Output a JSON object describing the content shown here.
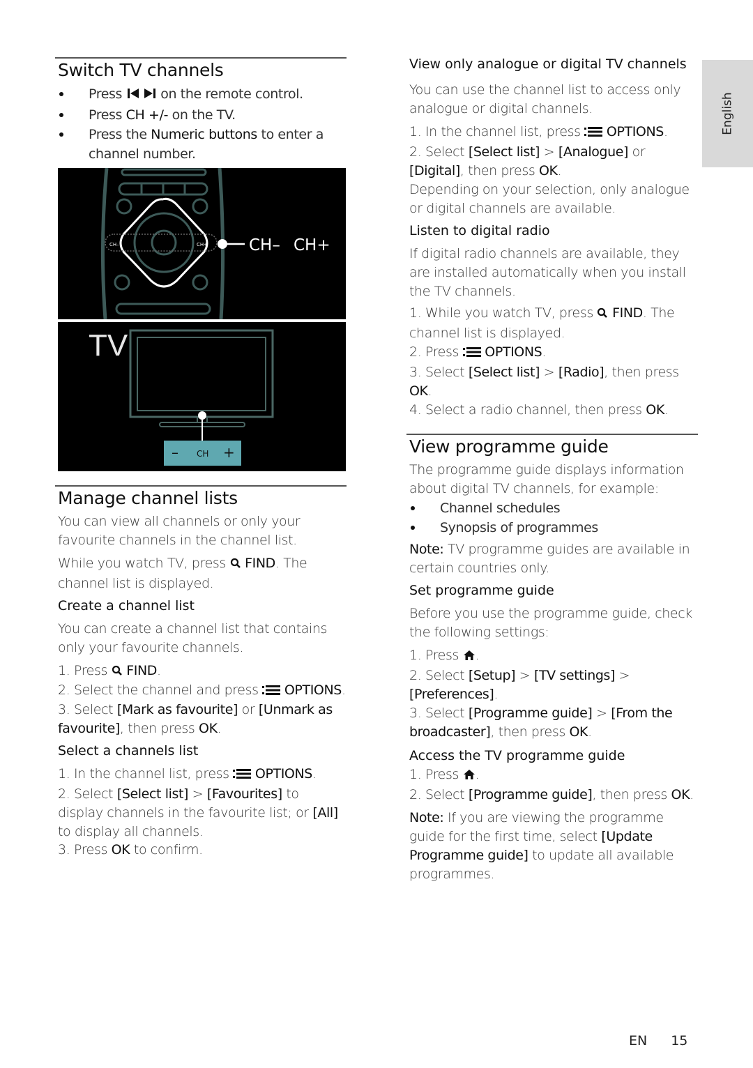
{
  "sidebar_tab": {
    "language": "English"
  },
  "footer": {
    "lang_code": "EN",
    "page_number": "15"
  },
  "icons": {
    "prev_next": "prev-next-track-icon",
    "find": "magnifier-icon",
    "options": "options-list-icon",
    "home": "home-icon"
  },
  "switch_channels": {
    "title": "Switch TV channels",
    "bullets": [
      {
        "pre": "Press ",
        "icon": "prev-next",
        "post": " on the remote control."
      },
      {
        "pre": "Press ",
        "em": "CH +/-",
        "post": " on the TV."
      },
      {
        "pre": "Press the ",
        "em": "Numeric buttons",
        "post": " to enter a channel number."
      }
    ],
    "illustration": {
      "remote_labels": {
        "ch_minus_small": "CH–",
        "ch_plus_small": "CH+",
        "ch_minus": "CH–",
        "ch_plus": "CH+"
      },
      "tv_label": "TV",
      "tv_buttons": {
        "minus": "–",
        "ch": "CH",
        "plus": "+"
      },
      "accent_color": "#5fa8b0",
      "outline_color": "#3d5a58"
    }
  },
  "manage_lists": {
    "title": "Manage channel lists",
    "intro": "You can view all channels or only your favourite channels in the channel list.",
    "find_pre": "While you watch TV, press ",
    "find_em": "FIND",
    "find_post": ". The channel list is displayed.",
    "create": {
      "heading": "Create a channel list",
      "intro": "You can create a channel list that contains only your favourite channels.",
      "step1_pre": "1. Press ",
      "step1_em": "FIND",
      "step1_post": ".",
      "step2_pre": "2. Select the channel and press ",
      "step2_em": "OPTIONS",
      "step2_post": ".",
      "step3_pre": "3. Select ",
      "step3_em1": "[Mark as favourite]",
      "step3_mid": " or ",
      "step3_em2": "[Unmark as favourite]",
      "step3_mid2": ", then press ",
      "step3_em3": "OK",
      "step3_post": "."
    },
    "select": {
      "heading": "Select a channels list",
      "step1_pre": "1. In the channel list, press ",
      "step1_em": "OPTIONS",
      "step1_post": ".",
      "step2_pre": "2. Select ",
      "step2_em1": "[Select list]",
      "step2_mid": " > ",
      "step2_em2": "[Favourites]",
      "step2_mid2": " to display channels in the favourite list; or ",
      "step2_em3": "[All]",
      "step2_post": " to display all channels.",
      "step3_pre": "3. Press ",
      "step3_em": "OK",
      "step3_post": " to confirm."
    }
  },
  "analogue_digital": {
    "heading": "View only analogue or digital TV channels",
    "intro": "You can use the channel list to access only analogue or digital channels.",
    "step1_pre": "1. In the channel list, press ",
    "step1_em": "OPTIONS",
    "step1_post": ".",
    "step2_pre": "2. Select ",
    "step2_em1": "[Select list]",
    "step2_mid": " > ",
    "step2_em2": "[Analogue]",
    "step2_mid2": " or ",
    "step2_em3": "[Digital]",
    "step2_mid3": ", then press ",
    "step2_em4": "OK",
    "step2_post": ".",
    "result": "Depending on your selection, only analogue or digital channels are available."
  },
  "digital_radio": {
    "heading": "Listen to digital radio",
    "intro": "If digital radio channels are available, they are installed automatically when you install the TV channels.",
    "step1_pre": "1. While you watch TV, press ",
    "step1_em": "FIND",
    "step1_post": ". The channel list is displayed.",
    "step2_pre": "2. Press ",
    "step2_em": "OPTIONS",
    "step2_post": ".",
    "step3_pre": "3. Select ",
    "step3_em1": "[Select list]",
    "step3_mid": " > ",
    "step3_em2": "[Radio]",
    "step3_mid2": ", then press ",
    "step3_em3": "OK",
    "step3_post": ".",
    "step4_pre": "4. Select a radio channel, then press ",
    "step4_em": "OK",
    "step4_post": "."
  },
  "programme_guide": {
    "title": "View programme guide",
    "intro": "The programme guide displays information about digital TV channels, for example:",
    "bullets": [
      "Channel schedules",
      "Synopsis of programmes"
    ],
    "note_label": "Note:",
    "note_text": " TV programme guides are available in certain countries only.",
    "set": {
      "heading": "Set programme guide",
      "intro": "Before you use the programme guide, check the following settings:",
      "step1_pre": "1. Press ",
      "step1_post": ".",
      "step2_pre": "2. Select ",
      "step2_em1": "[Setup]",
      "step2_mid": " > ",
      "step2_em2": "[TV settings]",
      "step2_mid2": " > ",
      "step2_em3": "[Preferences]",
      "step2_post": ".",
      "step3_pre": "3. Select ",
      "step3_em1": "[Programme guide]",
      "step3_mid": " > ",
      "step3_em2": "[From the broadcaster]",
      "step3_mid2": ", then press ",
      "step3_em3": "OK",
      "step3_post": "."
    },
    "access": {
      "heading": "Access the TV programme guide",
      "step1_pre": "1. Press ",
      "step1_post": ".",
      "step2_pre": "2. Select ",
      "step2_em1": "[Programme guide]",
      "step2_mid": ", then press ",
      "step2_em2": "OK",
      "step2_post": ".",
      "note_label": "Note:",
      "note_pre": " If you are viewing the programme guide for the first time, select ",
      "note_em": "[Update Programme guide]",
      "note_post": " to update all available programmes."
    }
  }
}
